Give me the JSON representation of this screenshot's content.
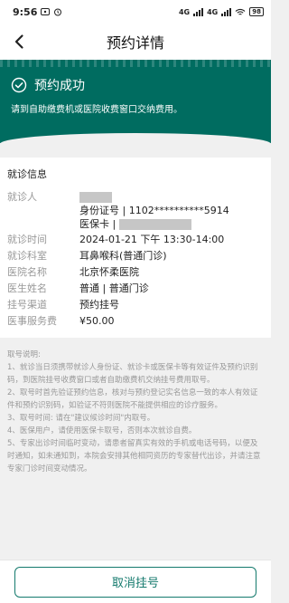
{
  "status_bar": {
    "time": "9:56",
    "network1": "4G",
    "network2": "4G",
    "battery": "98"
  },
  "header": {
    "title": "预约详情"
  },
  "banner": {
    "title": "预约成功",
    "desc": "请到自助缴费机或医院收费窗口交纳费用。",
    "bg_color": "#006c60"
  },
  "visit_info": {
    "heading": "就诊信息",
    "patient_label": "就诊人",
    "id_text": "身份证号 | 1102**********5914",
    "insurance_label": "医保卡 |",
    "rows": [
      {
        "label": "就诊时间",
        "value": "2024-01-21 下午 13:30-14:00"
      },
      {
        "label": "就诊科室",
        "value": "耳鼻喉科(普通门诊)"
      },
      {
        "label": "医院名称",
        "value": "北京怀柔医院"
      },
      {
        "label": "医生姓名",
        "value": "普通 | 普通门诊"
      },
      {
        "label": "挂号渠道",
        "value": "预约挂号"
      },
      {
        "label": "医事服务费",
        "value": "¥50.00"
      }
    ]
  },
  "notes": {
    "title": "取号说明:",
    "items": [
      "1、就诊当日须携带就诊人身份证、就诊卡或医保卡等有效证件及预约识别码，到医院挂号收费窗口或者自助缴费机交纳挂号费用取号。",
      "2、取号时首先验证预约信息，核对与预约登记实名信息一致的本人有效证件和预约识别码，如验证不符则医院不能提供相应的诊疗服务。",
      "3、取号时间: 请在\"建议候诊时间\"内取号。",
      "4、医保用户，请使用医保卡取号，否则本次就诊自费。",
      "5、专家出诊时间临时变动，请患者留真实有效的手机或电话号码，以便及时通知，如未通知到，本院会安排其他相同资历的专家替代出诊，并请注意专家门诊时间变动情况。"
    ]
  },
  "footer": {
    "cancel_label": "取消挂号",
    "accent": "#147a6d"
  }
}
